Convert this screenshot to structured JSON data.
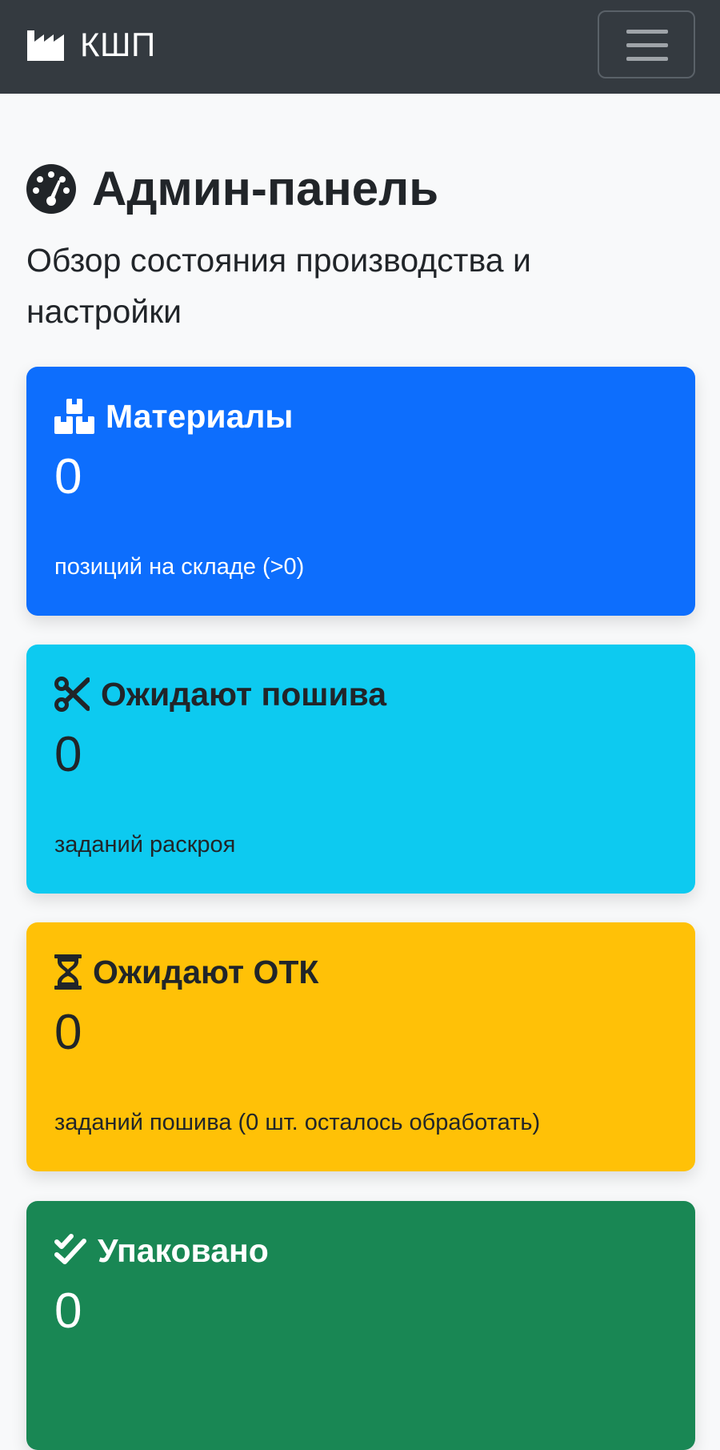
{
  "navbar": {
    "brand_icon": "industry-icon",
    "brand_text": "КШП",
    "toggler_icon": "hamburger-menu-icon"
  },
  "header": {
    "icon": "dashboard-gauge-icon",
    "title": "Админ-панель",
    "subtitle": "Обзор состояния производства и настройки"
  },
  "cards": [
    {
      "icon": "boxes-icon",
      "title": "Материалы",
      "value": "0",
      "note": "позиций на складе (>0)",
      "color": "#0d6efd"
    },
    {
      "icon": "scissors-icon",
      "title": "Ожидают пошива",
      "value": "0",
      "note": "заданий раскроя",
      "color": "#0dcaf0"
    },
    {
      "icon": "hourglass-icon",
      "title": "Ожидают ОТК",
      "value": "0",
      "note": "заданий пошива (0 шт. осталось обработать)",
      "color": "#ffc107"
    },
    {
      "icon": "check-double-icon",
      "title": "Упаковано",
      "value": "0",
      "color": "#198754"
    }
  ]
}
